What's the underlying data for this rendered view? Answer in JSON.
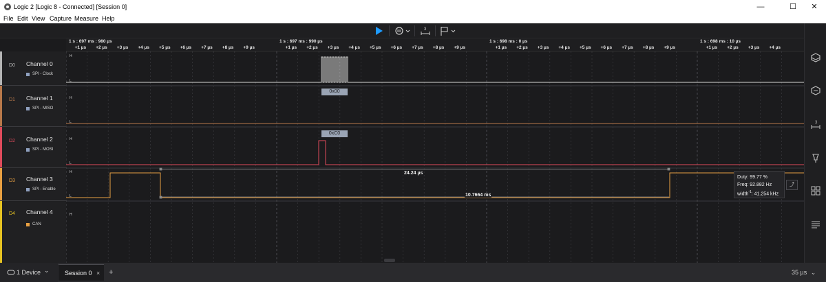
{
  "window": {
    "title": "Logic 2 [Logic 8 - Connected] [Session 0]",
    "minimize": "—",
    "maximize": "☐",
    "close": "✕"
  },
  "menu": [
    "File",
    "Edit",
    "View",
    "Capture",
    "Measure",
    "Help"
  ],
  "toolbar": {
    "play_color": "#1e9bff",
    "icons": [
      "play-icon",
      "trigger-settings-icon",
      "measure-icon",
      "flag-icon"
    ]
  },
  "timeline": {
    "major": [
      "1 s : 697 ms : 980 µs",
      "1 s : 697 ms : 990 µs",
      "1 s : 698 ms : 0 µs",
      "1 s : 698 ms : 10 µs"
    ],
    "minor": [
      "+1 µs",
      "+2 µs",
      "+3 µs",
      "+4 µs",
      "+5 µs",
      "+6 µs",
      "+7 µs",
      "+8 µs",
      "+9 µs"
    ],
    "last_minor": [
      "+1 µs",
      "+2 µs",
      "+3 µs",
      "+4 µs"
    ]
  },
  "channels": [
    {
      "id": "D0",
      "name": "Channel 0",
      "analyzer": "SPI - Clock",
      "color": "#b5b5b5",
      "analyzer_color": "#8fa0bf",
      "high": "H",
      "low": "L"
    },
    {
      "id": "D1",
      "name": "Channel 1",
      "analyzer": "SPI - MISO",
      "color": "#b8784a",
      "analyzer_color": "#8fa0bf",
      "high": "H",
      "low": "L"
    },
    {
      "id": "D2",
      "name": "Channel 2",
      "analyzer": "SPI - MOSI",
      "color": "#e04b5c",
      "analyzer_color": "#8fa0bf",
      "high": "H",
      "low": "L"
    },
    {
      "id": "D3",
      "name": "Channel 3",
      "analyzer": "SPI - Enable",
      "color": "#e8a042",
      "analyzer_color": "#8fa0bf",
      "high": "H",
      "low": "L"
    },
    {
      "id": "D4",
      "name": "Channel 4",
      "analyzer": "CAN",
      "color": "#e6c322",
      "analyzer_color": "#e8a042",
      "high": "H",
      "low": ""
    }
  ],
  "decoded": {
    "miso_value": "0x00",
    "mosi_value": "0xC0"
  },
  "measurements": {
    "high_time": "24.24 µs",
    "low_time": "10.7664 ms"
  },
  "tooltip": {
    "duty": "Duty: 99.77 %",
    "freq": "Freq: 92.882 Hz",
    "width_label": "width",
    "width_sup": "-1",
    "width_value": ": 41.254 kHz",
    "button": "⤴"
  },
  "bottom": {
    "device_tab": "1 Device",
    "session_tab": "Session 0",
    "session_close": "×",
    "add_tab": "+",
    "zoom_level": "35 µs",
    "chevron": "⌄"
  }
}
